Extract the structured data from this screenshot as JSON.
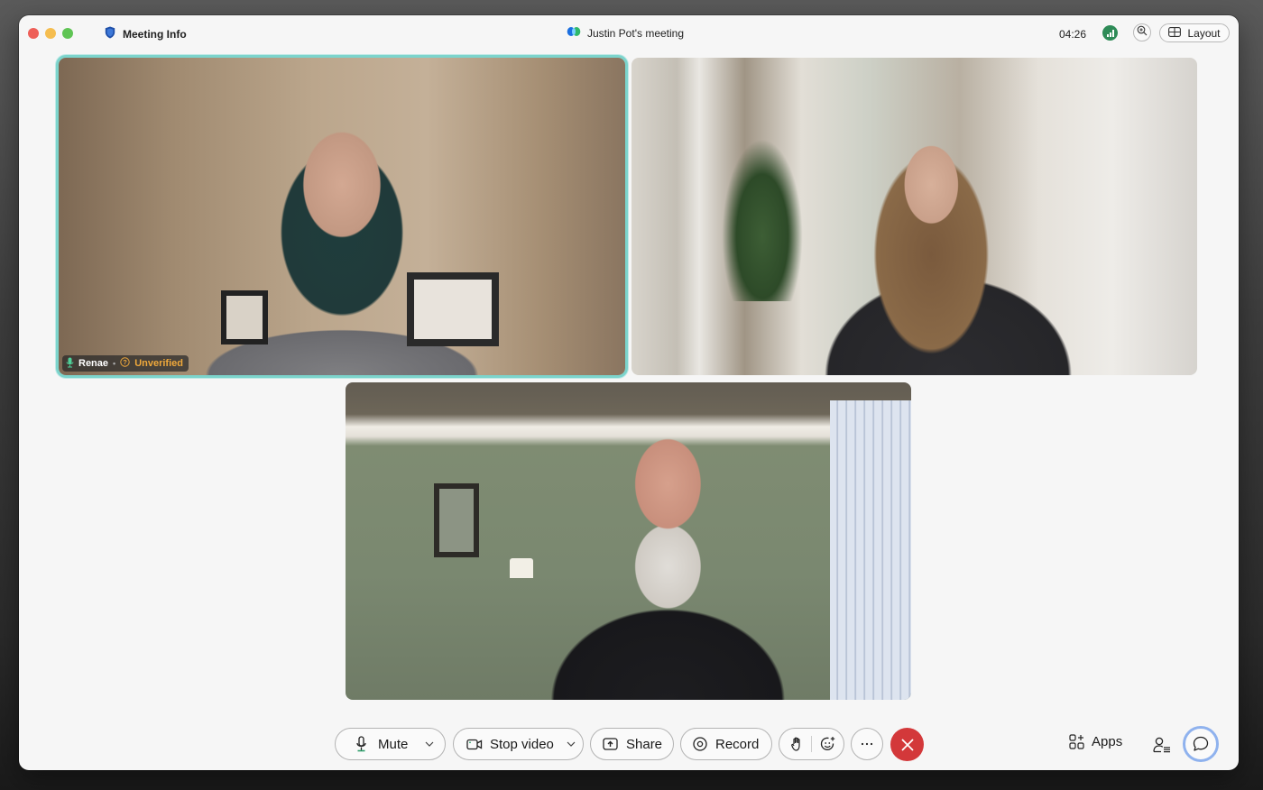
{
  "window": {
    "meeting_info_label": "Meeting Info",
    "title": "Justin Pot's meeting",
    "timer": "04:26",
    "layout_label": "Layout"
  },
  "participants": [
    {
      "name": "Renae",
      "status": "Unverified",
      "active_speaker": true,
      "muted": false
    },
    {
      "name": "",
      "status": "",
      "active_speaker": false
    },
    {
      "name": "",
      "status": "",
      "active_speaker": false
    }
  ],
  "controls": {
    "mute_label": "Mute",
    "stop_video_label": "Stop video",
    "share_label": "Share",
    "record_label": "Record",
    "apps_label": "Apps"
  },
  "colors": {
    "active_speaker_border": "#7cd4cc",
    "unverified": "#f0a93b",
    "end_call": "#d3383a",
    "signal_good": "#2e8b57",
    "chat_focus_ring": "#8fb2ee"
  }
}
